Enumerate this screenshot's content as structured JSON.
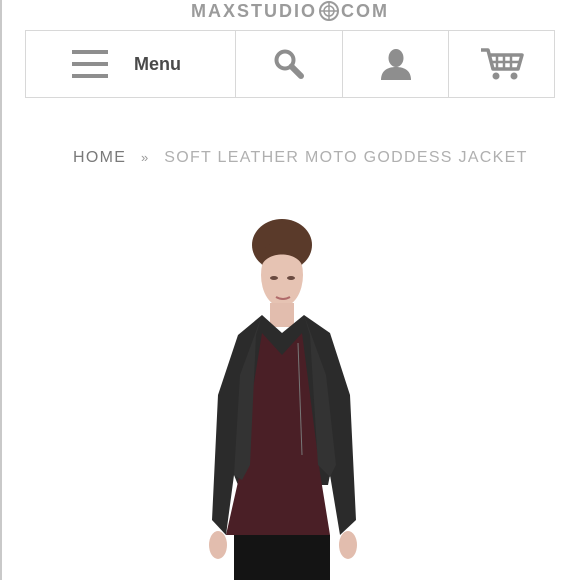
{
  "header": {
    "logo_left": "MAXSTUDIO",
    "logo_right": "COM",
    "logo_icon": "globe-icon"
  },
  "nav": {
    "menu_label": "Menu",
    "menu_icon": "hamburger-icon",
    "search_icon": "search-icon",
    "account_icon": "user-icon",
    "cart_icon": "cart-icon"
  },
  "breadcrumb": {
    "home": "HOME",
    "separator": "»",
    "current": "SOFT LEATHER MOTO GODDESS JACKET"
  },
  "product": {
    "image_icon": "model-photo",
    "colors": {
      "jacket": "#2b2b2b",
      "top": "#4a1f26",
      "skin": "#e6c3b3",
      "hair": "#5a3a2a"
    }
  },
  "colors": {
    "icon_gray": "#8e8e8e",
    "border": "#d8d8d8",
    "text_dark": "#4a4a4a"
  }
}
